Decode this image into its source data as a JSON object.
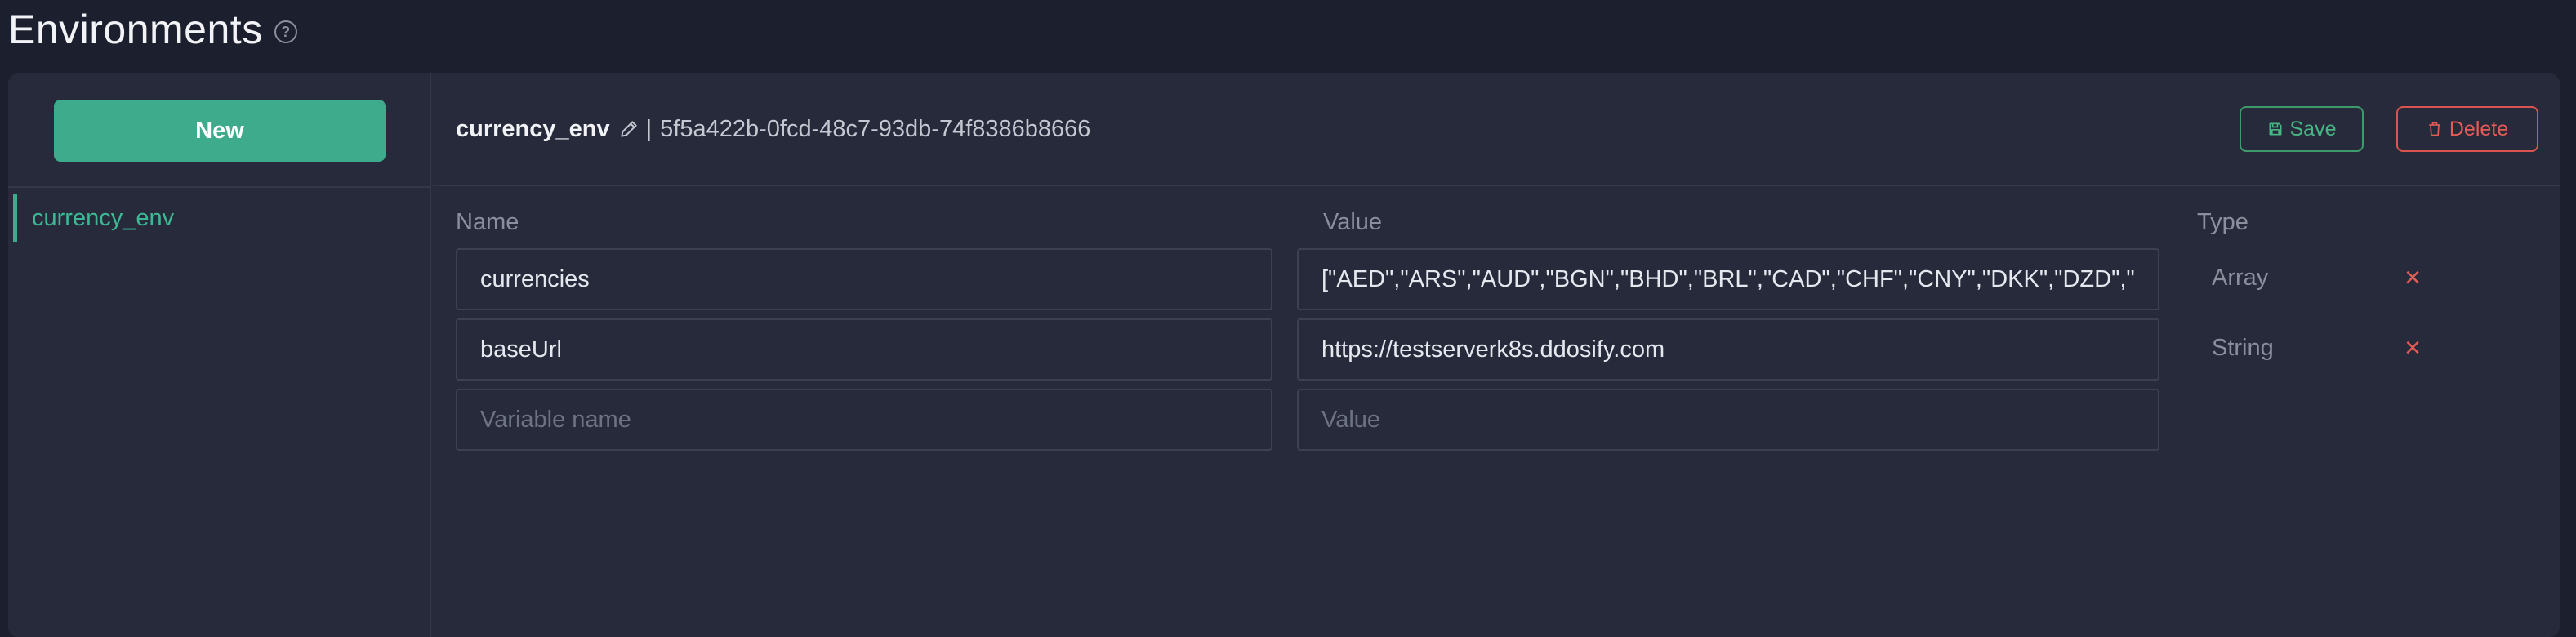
{
  "page": {
    "title": "Environments"
  },
  "sidebar": {
    "new_label": "New",
    "items": [
      {
        "label": "currency_env",
        "selected": true
      }
    ]
  },
  "env": {
    "name": "currency_env",
    "separator": "|",
    "id": "5f5a422b-0fcd-48c7-93db-74f8386b8666"
  },
  "actions": {
    "save_label": "Save",
    "delete_label": "Delete"
  },
  "table": {
    "columns": [
      "Name",
      "Value",
      "Type"
    ],
    "rows": [
      {
        "name": "currencies",
        "value": "[\"AED\",\"ARS\",\"AUD\",\"BGN\",\"BHD\",\"BRL\",\"CAD\",\"CHF\",\"CNY\",\"DKK\",\"DZD\",\"EUR",
        "type": "Array"
      },
      {
        "name": "baseUrl",
        "value": "https://testserverk8s.ddosify.com",
        "type": "String"
      }
    ],
    "new_row": {
      "name_placeholder": "Variable name",
      "value_placeholder": "Value"
    }
  },
  "colors": {
    "accent": "#3eab8c",
    "save": "#48b585",
    "delete": "#e45b57"
  },
  "icons": [
    "help-circle-icon",
    "pencil-icon",
    "floppy-disk-icon",
    "trash-icon",
    "close-icon"
  ]
}
